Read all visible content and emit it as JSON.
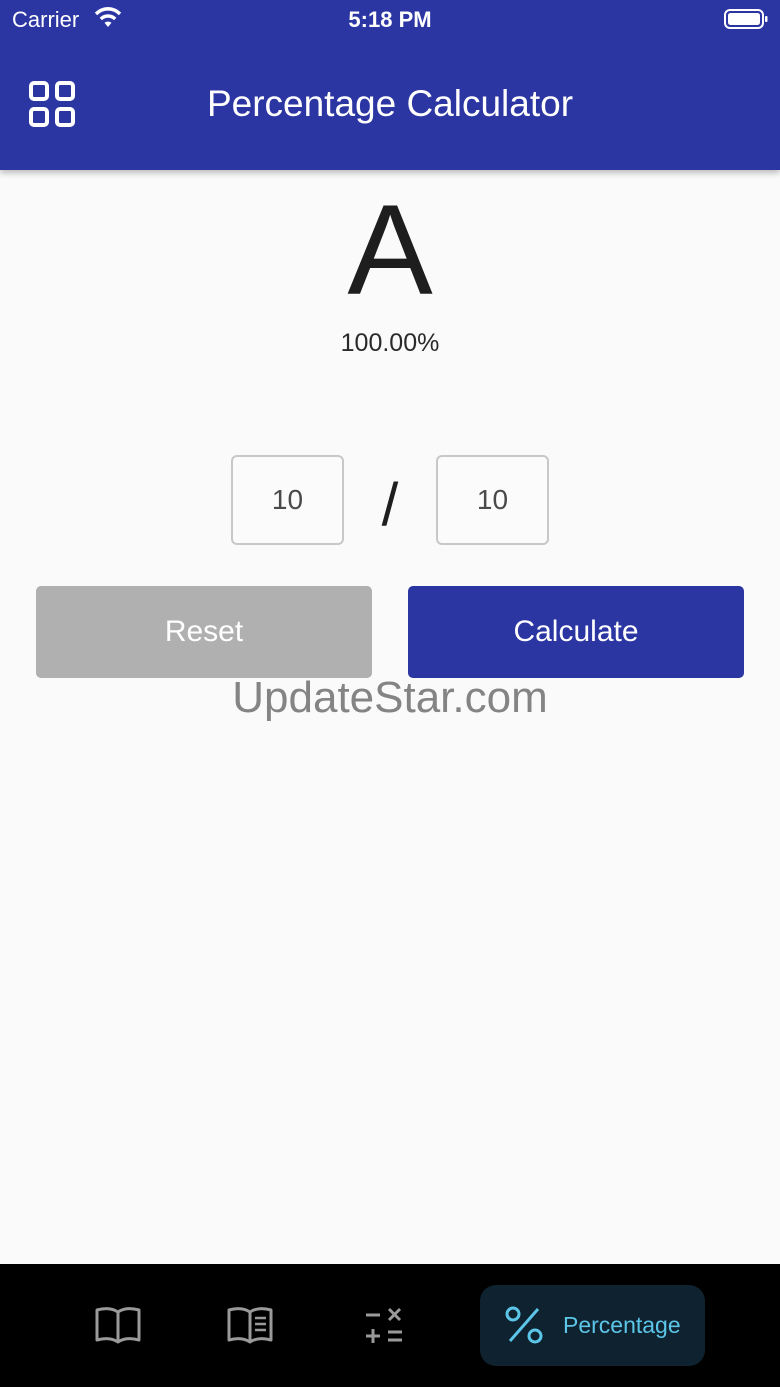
{
  "status_bar": {
    "carrier": "Carrier",
    "time": "5:18 PM"
  },
  "app_bar": {
    "title": "Percentage Calculator",
    "menu_icon": "grid-icon"
  },
  "result": {
    "grade": "A",
    "percent": "100.00%"
  },
  "inputs": {
    "numerator": "10",
    "separator": "/",
    "denominator": "10"
  },
  "buttons": {
    "reset_label": "Reset",
    "calculate_label": "Calculate"
  },
  "watermark": "UpdateStar.com",
  "bottom_nav": {
    "items": [
      {
        "icon": "open-book-icon"
      },
      {
        "icon": "book-notes-icon"
      },
      {
        "icon": "calculator-ops-icon"
      },
      {
        "icon": "percent-icon",
        "label": "Percentage",
        "active": true
      }
    ]
  },
  "colors": {
    "primary": "#2b36a3",
    "reset_button": "#b0b0b0",
    "nav_active_text": "#5cc6e8",
    "nav_active_bg": "#0f2230"
  }
}
